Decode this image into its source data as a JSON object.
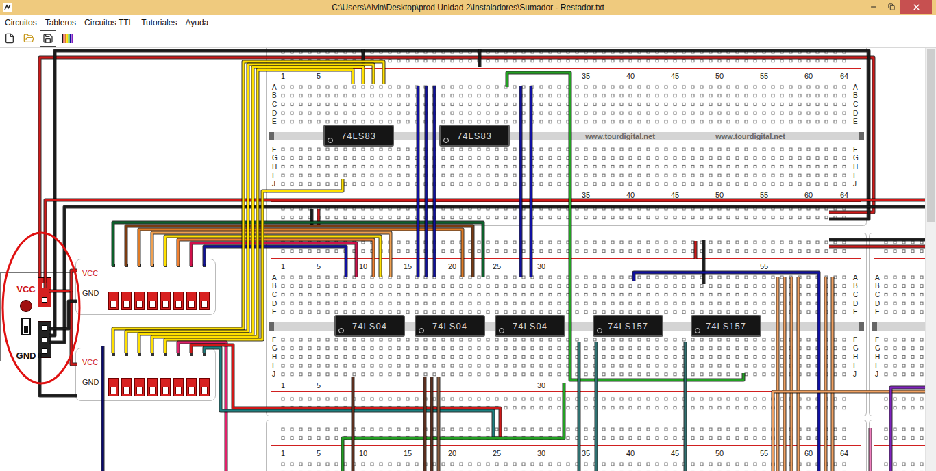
{
  "window": {
    "title": "C:\\Users\\Alvin\\Desktop\\prod Unidad 2\\Instaladores\\Sumador - Restador.txt"
  },
  "menu": [
    {
      "label": "Circuitos"
    },
    {
      "label": "Tableros"
    },
    {
      "label": "Circuitos TTL"
    },
    {
      "label": "Tutoriales"
    },
    {
      "label": "Ayuda"
    }
  ],
  "breadboards": [
    {
      "top_numbers": [
        "1",
        "5",
        "35",
        "40",
        "45",
        "50",
        "55",
        "60",
        "64"
      ],
      "bottom_numbers": [
        "35",
        "40",
        "45",
        "50",
        "55",
        "60",
        "64"
      ],
      "left_letters": [
        "A",
        "B",
        "C",
        "D",
        "E",
        "F",
        "G",
        "H",
        "I",
        "J"
      ],
      "right_letters": [
        "A",
        "B",
        "C",
        "D",
        "E",
        "F",
        "G",
        "H",
        "I",
        "J"
      ],
      "watermarks": [
        "www.tourdigital.net",
        "www.tourdigital.net"
      ],
      "chips": [
        {
          "label": "74LS83"
        },
        {
          "label": "74LS83"
        }
      ]
    },
    {
      "top_numbers": [
        "1",
        "5",
        "10",
        "15",
        "20",
        "25",
        "30",
        "55"
      ],
      "bottom_numbers": [
        "1",
        "5",
        "30"
      ],
      "left_letters": [
        "A",
        "B",
        "C",
        "D",
        "E",
        "F",
        "G",
        "H",
        "I",
        "J"
      ],
      "right_letters": [
        "A",
        "B",
        "C",
        "D",
        "E",
        "F",
        "G",
        "H",
        "I",
        "J"
      ],
      "watermarks": [],
      "chips": [
        {
          "label": "74LS04"
        },
        {
          "label": "74LS04"
        },
        {
          "label": "74LS04"
        },
        {
          "label": "74LS157"
        },
        {
          "label": "74LS157"
        }
      ]
    },
    {
      "top_numbers": [],
      "bottom_numbers": [],
      "left_letters": [
        "A",
        "B",
        "C",
        "D",
        "E",
        "F",
        "G",
        "H",
        "I",
        "J"
      ],
      "right_letters": [],
      "watermarks": [],
      "chips": []
    },
    {
      "top_numbers": [
        "1",
        "5",
        "10",
        "15",
        "20",
        "25",
        "30",
        "35",
        "40",
        "45",
        "50",
        "55",
        "60",
        "64"
      ],
      "bottom_numbers": [],
      "left_letters": [],
      "right_letters": [],
      "watermarks": [],
      "chips": []
    },
    {
      "top_numbers": [],
      "bottom_numbers": [],
      "left_letters": [],
      "right_letters": [],
      "watermarks": [],
      "chips": []
    }
  ],
  "power_supply": {
    "vcc_label": "VCC",
    "gnd_label": "GND"
  },
  "switch_banks": [
    {
      "vcc_label": "VCC",
      "gnd_label": "GND",
      "switches": [
        {
          "on": false
        },
        {
          "on": false
        },
        {
          "on": false
        },
        {
          "on": false
        },
        {
          "on": false
        },
        {
          "on": false
        },
        {
          "on": false
        },
        {
          "on": false
        }
      ]
    },
    {
      "vcc_label": "VCC",
      "gnd_label": "GND",
      "switches": [
        {
          "on": false
        },
        {
          "on": false
        },
        {
          "on": false
        },
        {
          "on": false
        },
        {
          "on": false
        },
        {
          "on": false
        },
        {
          "on": false
        },
        {
          "on": false
        }
      ]
    }
  ]
}
